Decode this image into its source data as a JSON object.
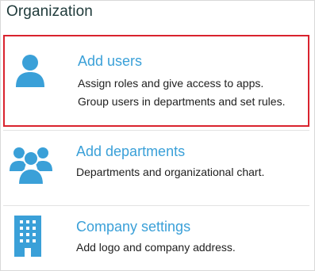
{
  "section": {
    "title": "Organization"
  },
  "colors": {
    "accent": "#3aa0d8",
    "selection_border": "#d9232e",
    "text": "#1e1e1e"
  },
  "cards": [
    {
      "icon": "user-icon",
      "title": "Add users",
      "desc_lines": [
        "Assign roles and give access to apps.",
        "Group users in departments and set rules."
      ],
      "selected": true
    },
    {
      "icon": "users-group-icon",
      "title": "Add departments",
      "desc_lines": [
        "Departments and organizational chart."
      ],
      "selected": false
    },
    {
      "icon": "building-icon",
      "title": "Company settings",
      "desc_lines": [
        "Add logo and company address."
      ],
      "selected": false
    }
  ]
}
